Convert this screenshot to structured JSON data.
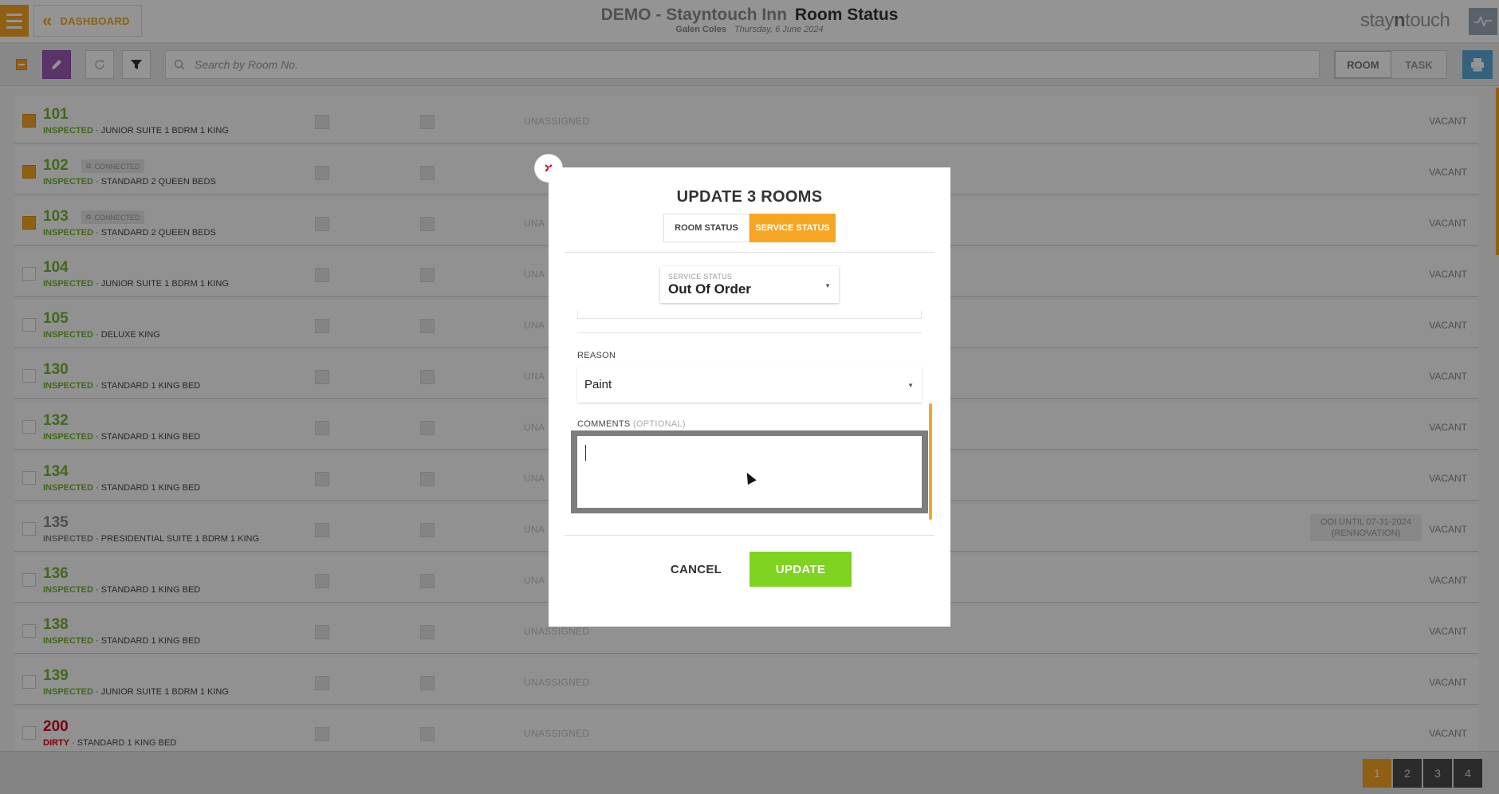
{
  "header": {
    "dashboard_label": "DASHBOARD",
    "hotel_name": "DEMO - Stayntouch Inn",
    "page_title": "Room Status",
    "user_name": "Galen Coles",
    "date": "Thursday, 6 June 2024",
    "logo_text_1": "stay",
    "logo_text_2": "n",
    "logo_text_3": "touch"
  },
  "toolbar": {
    "search_placeholder": "Search by Room No.",
    "view_room": "ROOM",
    "view_task": "TASK"
  },
  "colors": {
    "accent_orange": "#f6a623",
    "inspected_green": "#72b132",
    "dirty_red": "#d0021b",
    "update_green": "#7ed321",
    "edit_purple": "#9b59b6"
  },
  "rooms": [
    {
      "number": "101",
      "status": "INSPECTED",
      "type": "JUNIOR SUITE 1 BDRM 1 KING",
      "selected": true,
      "connected": "",
      "assignment": "UNASSIGNED",
      "ooi": "",
      "occupancy": "VACANT"
    },
    {
      "number": "102",
      "status": "INSPECTED",
      "type": "STANDARD 2 QUEEN BEDS",
      "selected": true,
      "connected": "CONNECTED",
      "assignment": "",
      "ooi": "",
      "occupancy": "VACANT"
    },
    {
      "number": "103",
      "status": "INSPECTED",
      "type": "STANDARD 2 QUEEN BEDS",
      "selected": true,
      "connected": "CONNECTED",
      "assignment": "UNA",
      "ooi": "",
      "occupancy": "VACANT"
    },
    {
      "number": "104",
      "status": "INSPECTED",
      "type": "JUNIOR SUITE 1 BDRM 1 KING",
      "selected": false,
      "connected": "",
      "assignment": "UNA",
      "ooi": "",
      "occupancy": "VACANT"
    },
    {
      "number": "105",
      "status": "INSPECTED",
      "type": "DELUXE KING",
      "selected": false,
      "connected": "",
      "assignment": "UNA",
      "ooi": "",
      "occupancy": "VACANT"
    },
    {
      "number": "130",
      "status": "INSPECTED",
      "type": "STANDARD 1 KING BED",
      "selected": false,
      "connected": "",
      "assignment": "UNA",
      "ooi": "",
      "occupancy": "VACANT"
    },
    {
      "number": "132",
      "status": "INSPECTED",
      "type": "STANDARD 1 KING BED",
      "selected": false,
      "connected": "",
      "assignment": "UNA",
      "ooi": "",
      "occupancy": "VACANT"
    },
    {
      "number": "134",
      "status": "INSPECTED",
      "type": "STANDARD 1 KING BED",
      "selected": false,
      "connected": "",
      "assignment": "UNA",
      "ooi": "",
      "occupancy": "VACANT"
    },
    {
      "number": "135",
      "status": "INSPECTED",
      "type": "PRESIDENTIAL SUITE 1 BDRM 1 KING",
      "selected": false,
      "connected": "",
      "assignment": "UNA",
      "ooi_line1": "OOI UNTIL 07-31-2024",
      "ooi_line2": "(RENNOVATION)",
      "occupancy": "VACANT",
      "muted": true
    },
    {
      "number": "136",
      "status": "INSPECTED",
      "type": "STANDARD 1 KING BED",
      "selected": false,
      "connected": "",
      "assignment": "UNA",
      "ooi": "",
      "occupancy": "VACANT"
    },
    {
      "number": "138",
      "status": "INSPECTED",
      "type": "STANDARD 1 KING BED",
      "selected": false,
      "connected": "",
      "assignment": "UNASSIGNED",
      "ooi": "",
      "occupancy": "VACANT"
    },
    {
      "number": "139",
      "status": "INSPECTED",
      "type": "JUNIOR SUITE 1 BDRM 1 KING",
      "selected": false,
      "connected": "",
      "assignment": "UNASSIGNED",
      "ooi": "",
      "occupancy": "VACANT"
    },
    {
      "number": "200",
      "status": "DIRTY",
      "type": "STANDARD 1 KING BED",
      "selected": false,
      "connected": "",
      "assignment": "UNASSIGNED",
      "ooi": "",
      "occupancy": "VACANT",
      "dirty": true
    }
  ],
  "pagination": {
    "pages": [
      "1",
      "2",
      "3",
      "4"
    ],
    "current": "1"
  },
  "modal": {
    "title": "UPDATE 3 ROOMS",
    "tab_room_status": "ROOM STATUS",
    "tab_service_status": "SERVICE STATUS",
    "service_status_label": "SERVICE STATUS",
    "service_status_value": "Out Of Order",
    "reason_label": "REASON",
    "reason_value": "Paint",
    "comments_label": "COMMENTS",
    "comments_optional": "(OPTIONAL)",
    "comments_value": "",
    "cancel_label": "CANCEL",
    "update_label": "UPDATE"
  }
}
